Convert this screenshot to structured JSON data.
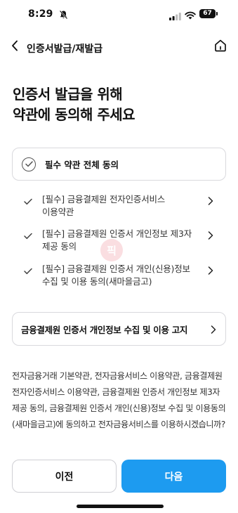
{
  "status_bar": {
    "time": "8:29",
    "battery": "67",
    "icons": [
      "bell-muted-icon",
      "signal-icon",
      "wifi-icon",
      "battery-icon"
    ]
  },
  "nav": {
    "title": "인증서발급/재발급",
    "back_icon": "chevron-left-icon",
    "home_icon": "home-icon"
  },
  "headline": {
    "line1": "인증서 발급을 위해",
    "line2": "약관에 동의해 주세요"
  },
  "agree_all": {
    "label": "필수 약관 전체 동의",
    "checked": false
  },
  "terms": [
    {
      "line1": "[필수] 금융결제원 전자인증서비스",
      "line2": "이용약관"
    },
    {
      "line1": "[필수] 금융결제원 인증서 개인정보 제3자",
      "line2": "제공 동의"
    },
    {
      "line1": "[필수] 금융결제원 인증서 개인(신용)정보",
      "line2": "수집 및 이용 동의(새마을금고)"
    }
  ],
  "notice": {
    "label": "금융결제원 인증서 개인정보 수집 및 이용 고지"
  },
  "summary": "전자금융거래 기본약관, 전자금융서비스 이용약관, 금융결제원 전자인증서비스 이용약관, 금융결제원 인증서 개인정보 제3자 제공 동의, 금융결제원 인증서 개인(신용)정보 수집 및 이용동의(새마을금고)에 동의하고 전자금융서비스를 이용하시겠습니까?",
  "buttons": {
    "prev": "이전",
    "next": "다음"
  },
  "watermark": "픽",
  "colors": {
    "accent": "#1d9bf0",
    "border": "#d9d9dd",
    "text": "#111111"
  }
}
